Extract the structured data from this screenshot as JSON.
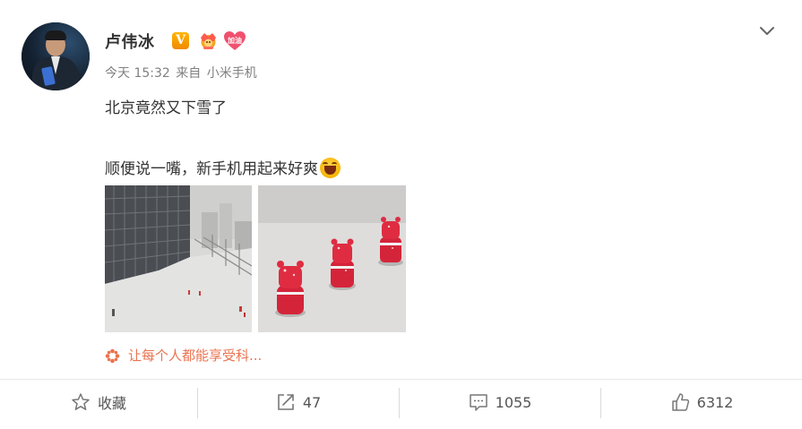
{
  "user": {
    "name": "卢伟冰",
    "badge_v": "V",
    "badge_heart_text": "加油"
  },
  "meta": {
    "time": "今天 15:32",
    "from": "来自",
    "source": "小米手机"
  },
  "post": {
    "line1": "北京竟然又下雪了",
    "line2": "顺便说一嘴，新手机用起来好爽"
  },
  "topic": {
    "text": "让每个人都能享受科..."
  },
  "actions": {
    "favorite_label": "收藏",
    "repost_count": "47",
    "comment_count": "1055",
    "like_count": "6312"
  },
  "colors": {
    "accent": "#eb7350",
    "text": "#333333",
    "muted": "#808080"
  },
  "icons": [
    "chevron-down-icon",
    "star-icon",
    "repost-icon",
    "comment-icon",
    "thumbs-up-icon",
    "flower-topic-icon",
    "verified-v-icon",
    "crown-badge-icon",
    "heart-badge-icon",
    "laugh-emoji-icon"
  ]
}
